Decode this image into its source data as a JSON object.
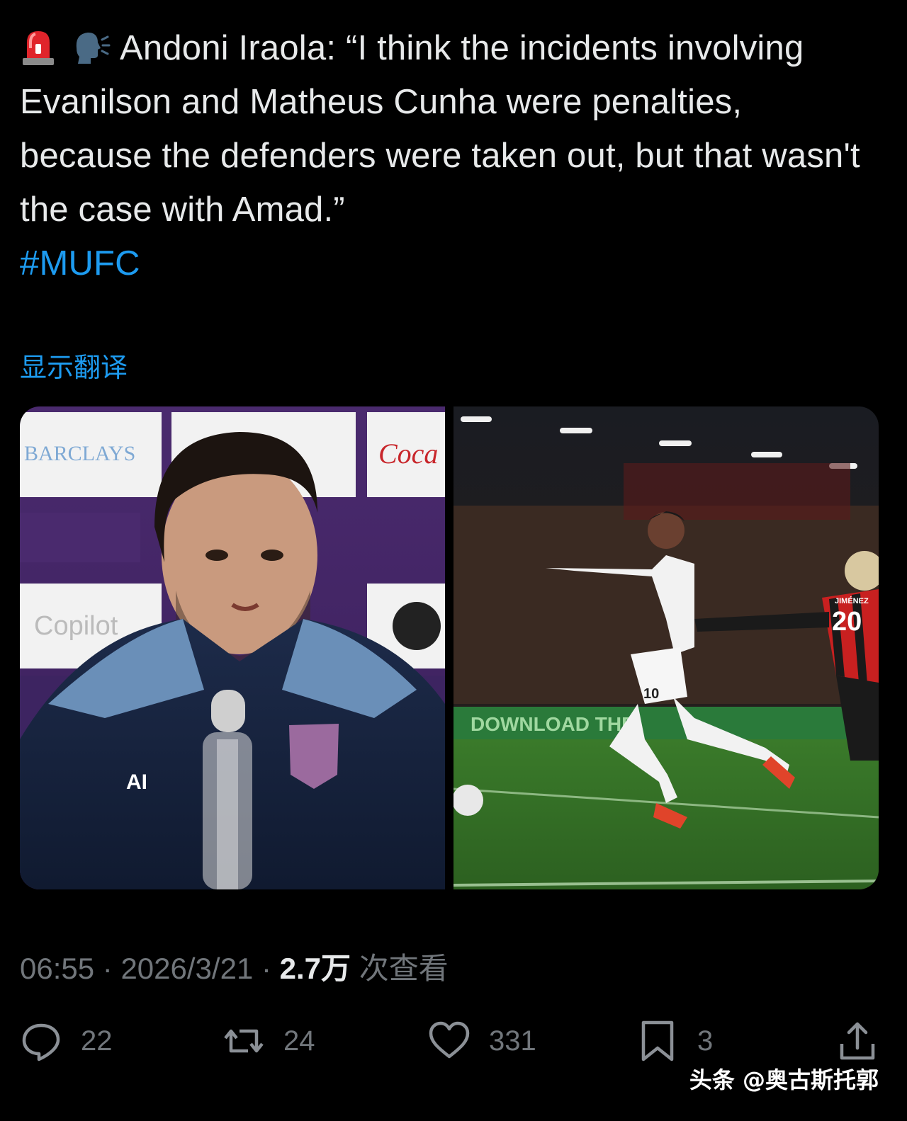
{
  "tweet": {
    "emojis": [
      "rotating-light-icon",
      "speaking-head-icon"
    ],
    "text_main": "Andoni Iraola: “I think the incidents involving Evanilson and Matheus Cunha were penalties, because the defenders were taken out, but that wasn't the case with Amad.”",
    "hashtag": "#MUFC",
    "translate_label": "显示翻译"
  },
  "media": {
    "image_1": {
      "sponsor_1": "BARCLAYS",
      "sponsor_2": "Copilot",
      "sponsor_3": "Coca",
      "initials": "AI"
    },
    "image_2": {
      "shirt_number_white": "10",
      "shirt_number_red": "20",
      "shirt_name_red": "JIMÉNEZ",
      "board_text": "DOWNLOAD THE"
    }
  },
  "meta": {
    "time": "06:55",
    "separator": "·",
    "date": "2026/3/21",
    "views_count": "2.7万",
    "views_label": "次查看"
  },
  "actions": {
    "replies": "22",
    "reposts": "24",
    "likes": "331",
    "bookmarks": "3"
  },
  "watermark": "头条 @奥古斯托郭",
  "colors": {
    "background": "#000000",
    "text": "#e7e9ea",
    "link": "#1d9bf0",
    "muted": "#71767b"
  }
}
